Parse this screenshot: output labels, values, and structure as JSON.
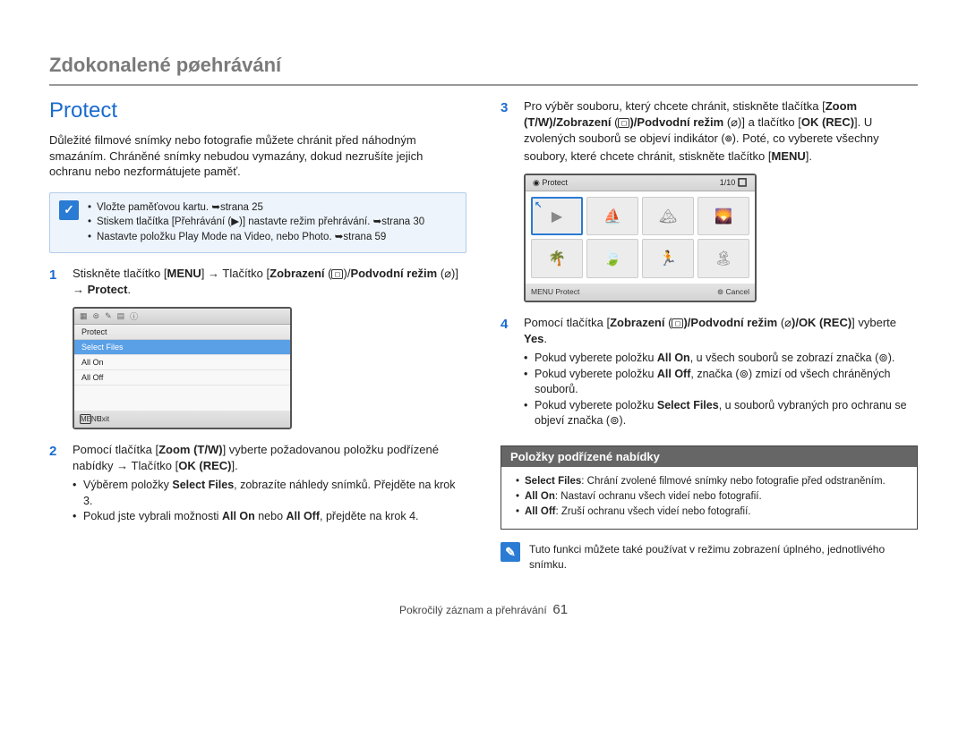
{
  "header": {
    "title": "Zdokonalené pøehrávání"
  },
  "left": {
    "section_title": "Protect",
    "intro": "Důležité filmové snímky nebo fotografie můžete chránit před náhodným smazáním. Chráněné snímky nebudou vymazány, dokud nezrušíte jejich ochranu nebo nezformátujete paměť.",
    "callout1": {
      "icon": "✓",
      "items": [
        "Vložte paměťovou kartu. ➥strana 25",
        "Stiskem tlačítka [Přehrávání (▶)] nastavte režim přehrávání. ➥strana 30",
        "Nastavte položku Play Mode na Video, nebo Photo. ➥strana 59"
      ]
    },
    "step1": {
      "num": "1",
      "text_a": "Stiskněte tlačítko [",
      "menu": "MENU",
      "text_b": "] → Tlačítko [",
      "zobraz": "Zobrazení",
      "text_c": " (",
      "icon1": "◻",
      "text_d": ")/",
      "podvod": "Podvodní režim",
      "text_e": " (",
      "icon2": "⌀",
      "text_f": ")] → ",
      "protect": "Protect",
      "text_g": "."
    },
    "screen1": {
      "title": "Protect",
      "opt_sel": "Select Files",
      "opt_on": "All On",
      "opt_off": "All Off",
      "footer_icon": "MENU",
      "footer_text": "Exit"
    },
    "step2": {
      "num": "2",
      "text_a": "Pomocí tlačítka [",
      "zoom": "Zoom (T/W)",
      "text_b": "] vyberte požadovanou položku podřízené nabídky → Tlačítko [",
      "ok": "OK (REC)",
      "text_c": "].",
      "bullets": [
        {
          "a": "Výběrem položky ",
          "b": "Select Files",
          "c": ", zobrazíte náhledy snímků. Přejděte na krok 3."
        },
        {
          "a": "Pokud jste vybrali možnosti ",
          "b": "All On",
          "c": " nebo ",
          "d": "All Off",
          "e": ", přejděte na krok 4."
        }
      ]
    }
  },
  "right": {
    "step3": {
      "num": "3",
      "text_a": "Pro výběr souboru, který chcete chránit, stiskněte tlačítka [",
      "zoom": "Zoom (T/W)",
      "slash1": "/",
      "zobraz": "Zobrazení",
      "lp1": " (",
      "icon1": "◻",
      "rp1": ")/",
      "podvod": "Podvodní režim",
      "lp2": " (",
      "icon2": "⌀",
      "rp2": ")]",
      "and": " a tlačítko [",
      "ok": "OK (REC)",
      "text_b": "]. U zvolených souborů se objeví indikátor (",
      "lock": "⊚",
      "text_c": "). Poté, co vyberete všechny soubory, které chcete chránit, stiskněte tlačítko [",
      "menu": "MENU",
      "text_d": "]."
    },
    "screen2": {
      "title_left": "◉ Protect",
      "title_right": "1/10 🔲",
      "footer_left": "MENU Protect",
      "footer_right": "⊚ Cancel"
    },
    "step4": {
      "num": "4",
      "text_a": "Pomocí tlačítka [",
      "zobraz": "Zobrazení",
      "lp1": " (",
      "icon1": "◻",
      "rp1": ")/",
      "podvod": "Podvodní režim",
      "lp2": " (",
      "icon2": "⌀",
      "rp2": ")/",
      "ok": "OK (REC)",
      "text_b": "] vyberte ",
      "yes": "Yes",
      "text_c": ".",
      "bullets": [
        {
          "a": "Pokud vyberete položku ",
          "b": "All On",
          "c": ", u všech souborů se zobrazí značka (⊚)."
        },
        {
          "a": "Pokud vyberete položku ",
          "b": "All Off",
          "c": ", značka (⊚) zmizí od všech chráněných souborů."
        },
        {
          "a": "Pokud vyberete položku ",
          "b": "Select Files",
          "c": ", u souborů vybraných pro ochranu se objeví značka (⊚)."
        }
      ]
    },
    "subbox": {
      "title": "Položky podřízené nabídky",
      "items": [
        {
          "a": "Select Files",
          "b": ": Chrání zvolené filmové snímky nebo fotografie před odstraněním."
        },
        {
          "a": "All On",
          "b": ": Nastaví ochranu všech videí nebo fotografií."
        },
        {
          "a": "All Off",
          "b": ": Zruší ochranu všech videí nebo fotografií."
        }
      ]
    },
    "note": {
      "icon": "✎",
      "text": "Tuto funkci můžete také používat v režimu zobrazení úplného, jednotlivého snímku."
    }
  },
  "footer": {
    "text": "Pokročilý záznam a přehrávání",
    "page": "61"
  }
}
